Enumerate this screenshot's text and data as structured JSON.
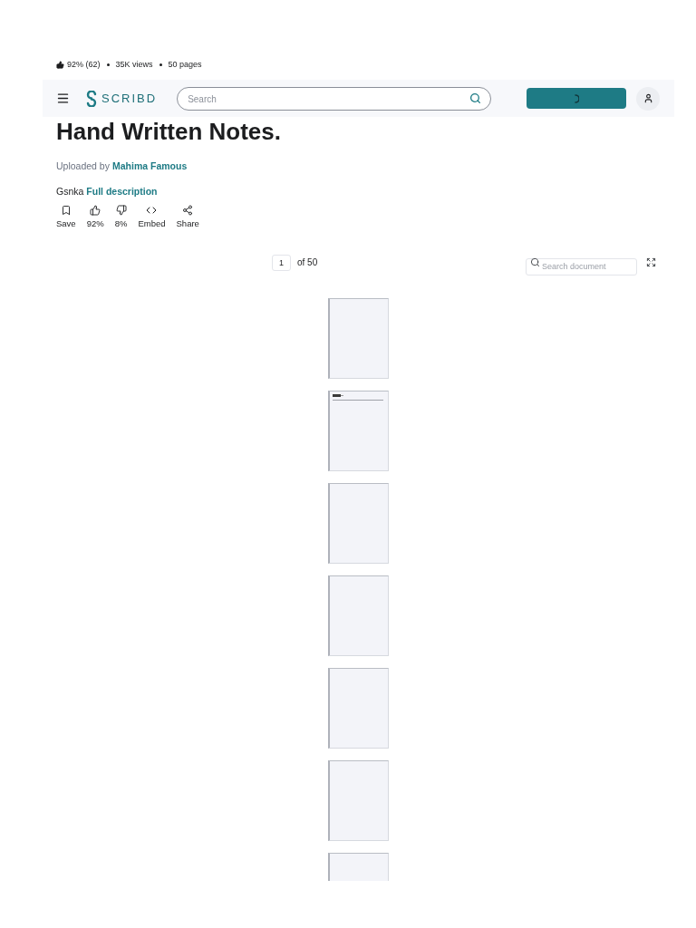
{
  "stats": {
    "rating": "92% (62)",
    "views": "35K views",
    "pages": "50 pages"
  },
  "header": {
    "logo": "SCRIBD",
    "search": {
      "placeholder": "Search"
    },
    "action_button": {
      "loading": true
    }
  },
  "document": {
    "title": "Hand Written Notes.",
    "uploaded_by": "Uploaded by",
    "uploader": "Mahima Famous",
    "description": "Gsnka",
    "description_link": "Full description"
  },
  "actions": [
    {
      "kind": "save",
      "label": "Save"
    },
    {
      "kind": "like",
      "label": "92%"
    },
    {
      "kind": "dislike",
      "label": "8%"
    },
    {
      "kind": "embed",
      "label": "Embed"
    },
    {
      "kind": "share",
      "label": "Share"
    }
  ],
  "pager": {
    "page": "1",
    "total": "of 50",
    "search": {
      "placeholder": "Search document"
    }
  },
  "pages": [
    {
      "kind": "blank",
      "cut_off": false
    },
    {
      "kind": "heading",
      "cut_off": false
    },
    {
      "kind": "blank",
      "cut_off": false
    },
    {
      "kind": "blank",
      "cut_off": false
    },
    {
      "kind": "blank",
      "cut_off": false
    },
    {
      "kind": "blank",
      "cut_off": false
    },
    {
      "kind": "blank",
      "cut_off": true
    }
  ]
}
